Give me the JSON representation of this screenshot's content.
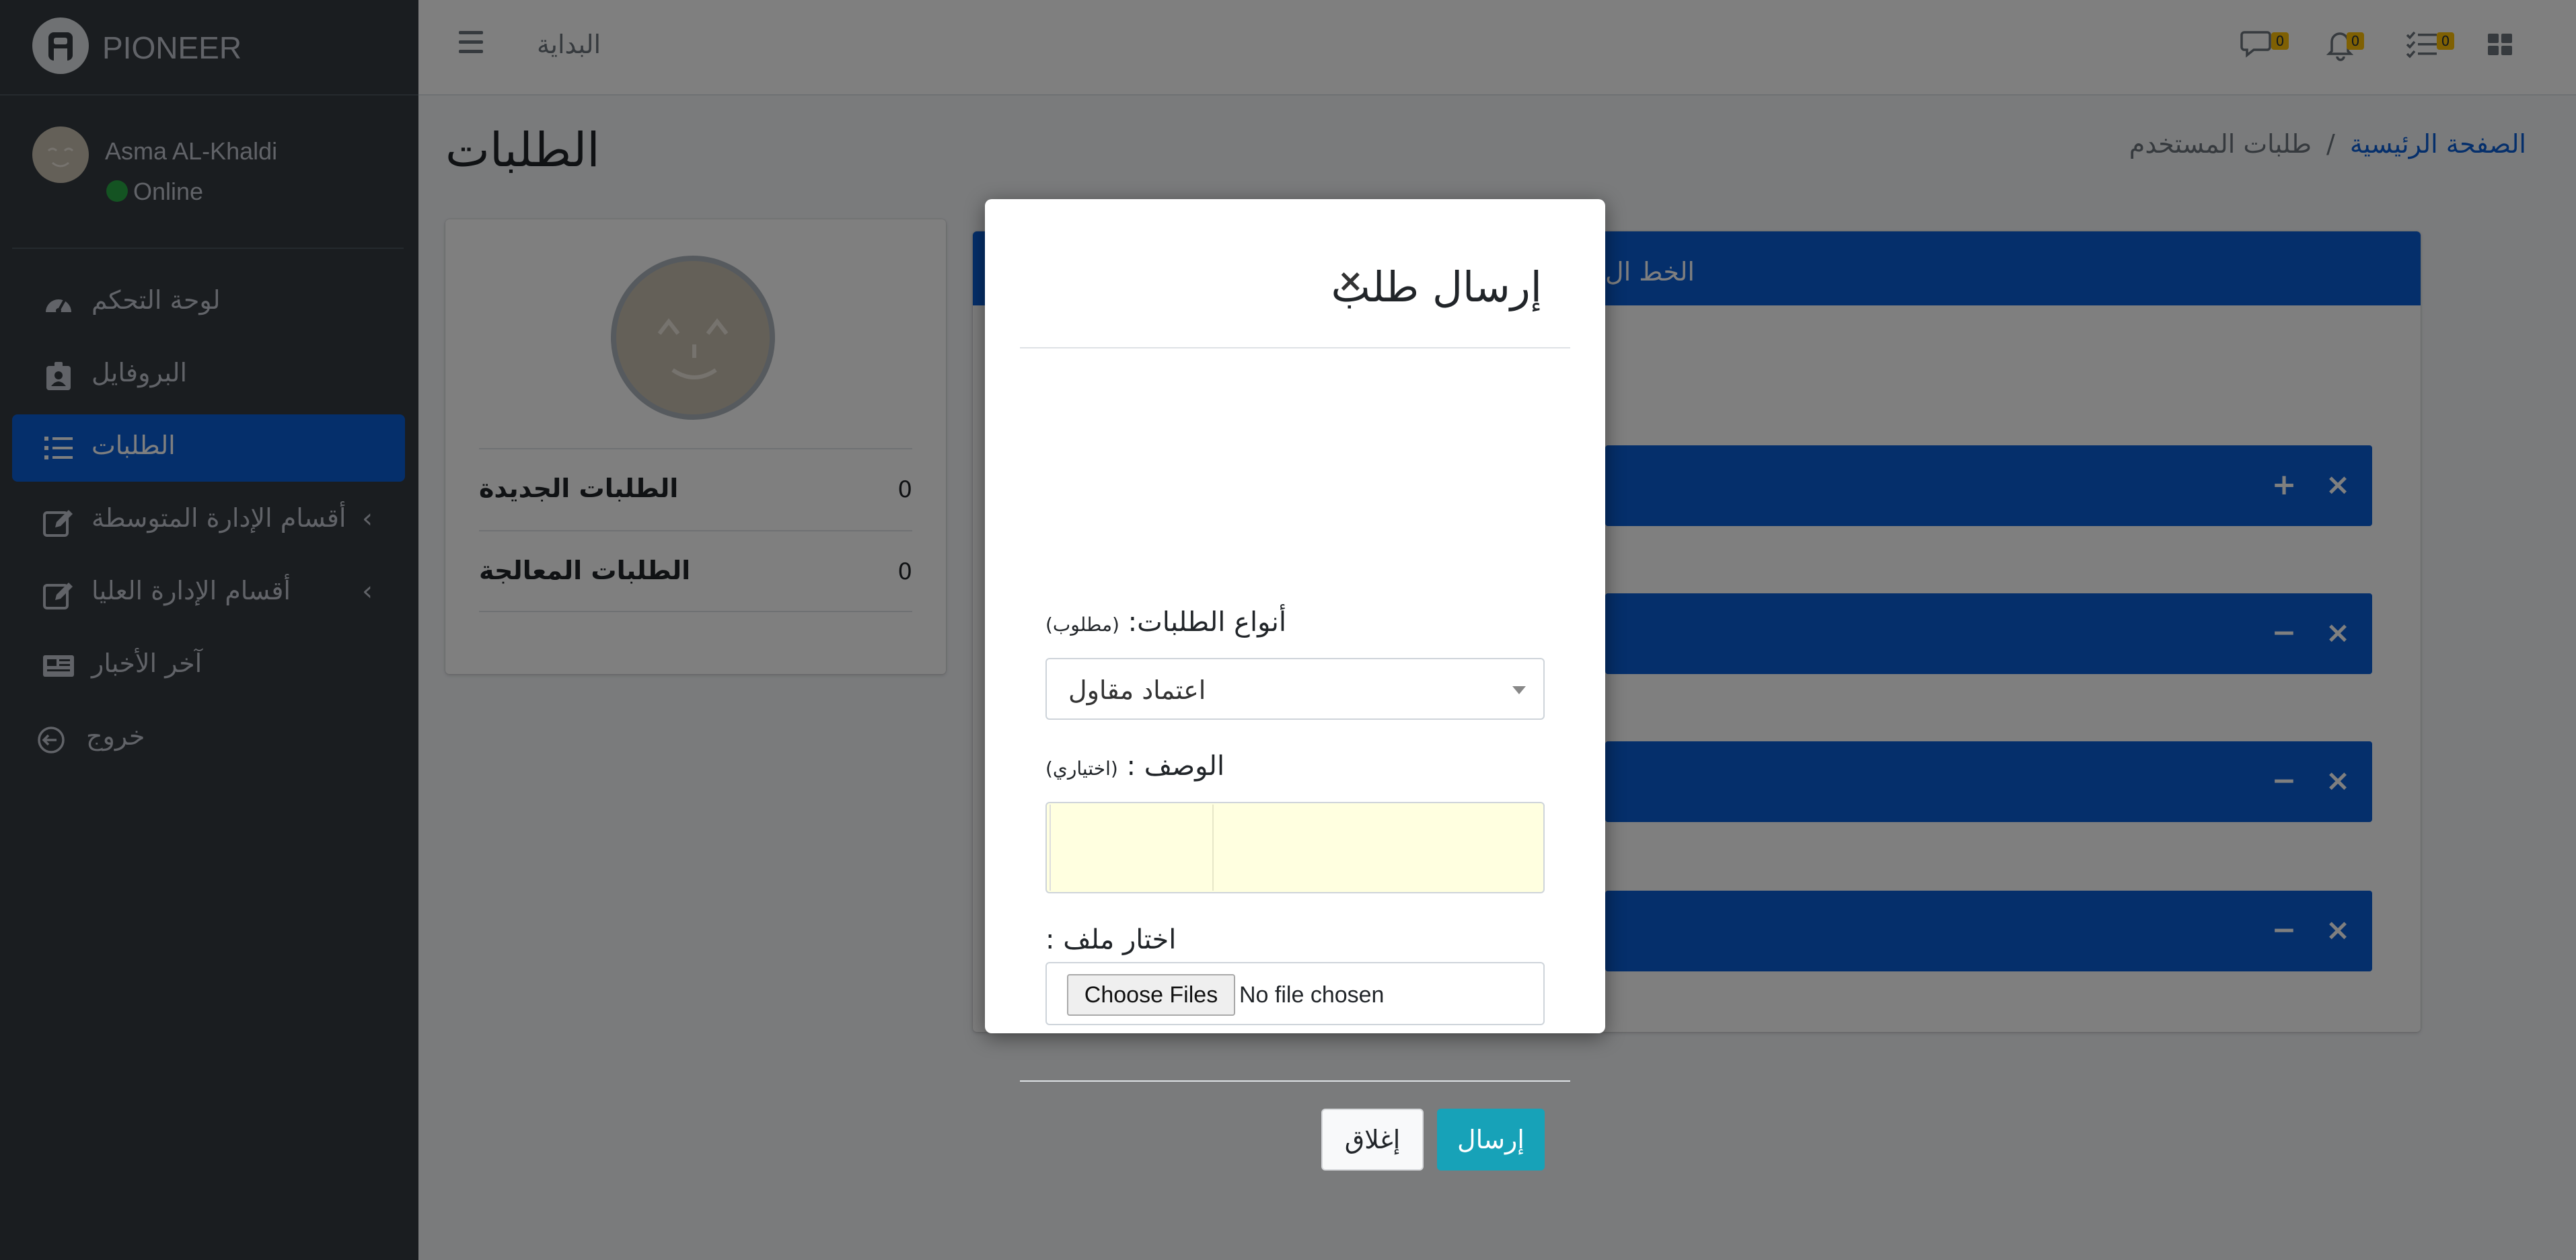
{
  "brand": {
    "name": "PIONEER"
  },
  "user": {
    "name": "Asma AL-Khaldi",
    "status": "Online"
  },
  "sidebar": {
    "items": [
      {
        "label": "لوحة التحكم",
        "icon": "dashboard-icon"
      },
      {
        "label": "البروفايل",
        "icon": "id-badge-icon"
      },
      {
        "label": "الطلبات",
        "icon": "list-icon",
        "active": true
      },
      {
        "label": "أقسام الإدارة المتوسطة",
        "icon": "edit-icon",
        "expandable": true
      },
      {
        "label": "أقسام الإدارة العليا",
        "icon": "edit-icon",
        "expandable": true
      },
      {
        "label": "آخر الأخبار",
        "icon": "newspaper-icon"
      },
      {
        "label": "خروج",
        "icon": "logout-icon"
      }
    ]
  },
  "header": {
    "home_link": "البداية",
    "badges": {
      "messages": "0",
      "notifications": "0",
      "tasks": "0"
    }
  },
  "page": {
    "title": "الطلبات",
    "breadcrumb": {
      "home": "الصفحة الرئيسية",
      "current": "طلبات المستخدم"
    }
  },
  "profile_card": {
    "stats": [
      {
        "label": "الطلبات الجديدة",
        "value": "0"
      },
      {
        "label": "الطلبات المعالجة",
        "value": "0"
      }
    ]
  },
  "main_card": {
    "title": "الخط ال"
  },
  "modal": {
    "title": "إرسال طلب",
    "request_type_label": "أنواع الطلبات:",
    "required_note": "(مطلوب)",
    "request_type_value": "اعتماد مقاول",
    "description_label": "الوصف :",
    "optional_note": "(اختياري)",
    "description_value": "",
    "file_label": "اختار ملف :",
    "file_button": "Choose Files",
    "file_status": "No file chosen",
    "send_button": "إرسال",
    "close_button": "إغلاق"
  },
  "colors": {
    "sidebar_bg": "#343a40",
    "primary": "#0b5ed7",
    "send": "#17a2b8",
    "badge": "#ffc107",
    "online": "#28a745"
  }
}
